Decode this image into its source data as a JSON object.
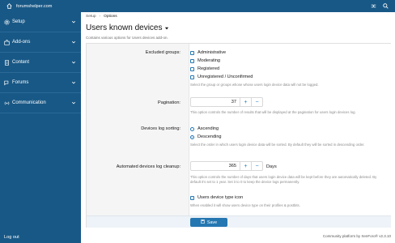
{
  "topbar": {
    "site": "forumshelper.com"
  },
  "sidebar": {
    "items": [
      {
        "label": "Setup"
      },
      {
        "label": "Add-ons"
      },
      {
        "label": "Content"
      },
      {
        "label": "Forums"
      },
      {
        "label": "Communication"
      }
    ],
    "logout": "Log out"
  },
  "breadcrumb": {
    "items": [
      "Setup",
      "Options"
    ]
  },
  "page": {
    "title": "Users known devices",
    "description": "Contains various options for Users devices add-on."
  },
  "form": {
    "excluded_groups": {
      "label": "Excluded groups:",
      "options": [
        "Administrative",
        "Moderating",
        "Registered",
        "Unregistered / Unconfirmed"
      ],
      "hint": "Select the group or groups whose whose users login device data will not be logged."
    },
    "pagination": {
      "label": "Pagination:",
      "value": "37",
      "hint": "This option controls the number of results that will be displayed at the pagination for users login devices log."
    },
    "sorting": {
      "label": "Devices log sorting:",
      "options": [
        "Ascending",
        "Descending"
      ],
      "selected": "Descending",
      "hint": "Select the order in which users login device data will be sorted. By default they will be sorted in descending order."
    },
    "cleanup": {
      "label": "Automated devices log cleanup:",
      "value": "365",
      "unit": "Days",
      "hint": "This option controls the number of days that users login device data will be kept before they are automatically deleted. By default it's set to 1 year. Set it to 0 to keep the device logs permanently."
    },
    "type_icon": {
      "label": "Users device type icon",
      "checked": true,
      "hint": "When enabled it will show users device type on their profiles & postbits."
    },
    "save_label": "Save"
  },
  "footer": {
    "credit": "Community platform by XenForo® v2.3.10"
  }
}
